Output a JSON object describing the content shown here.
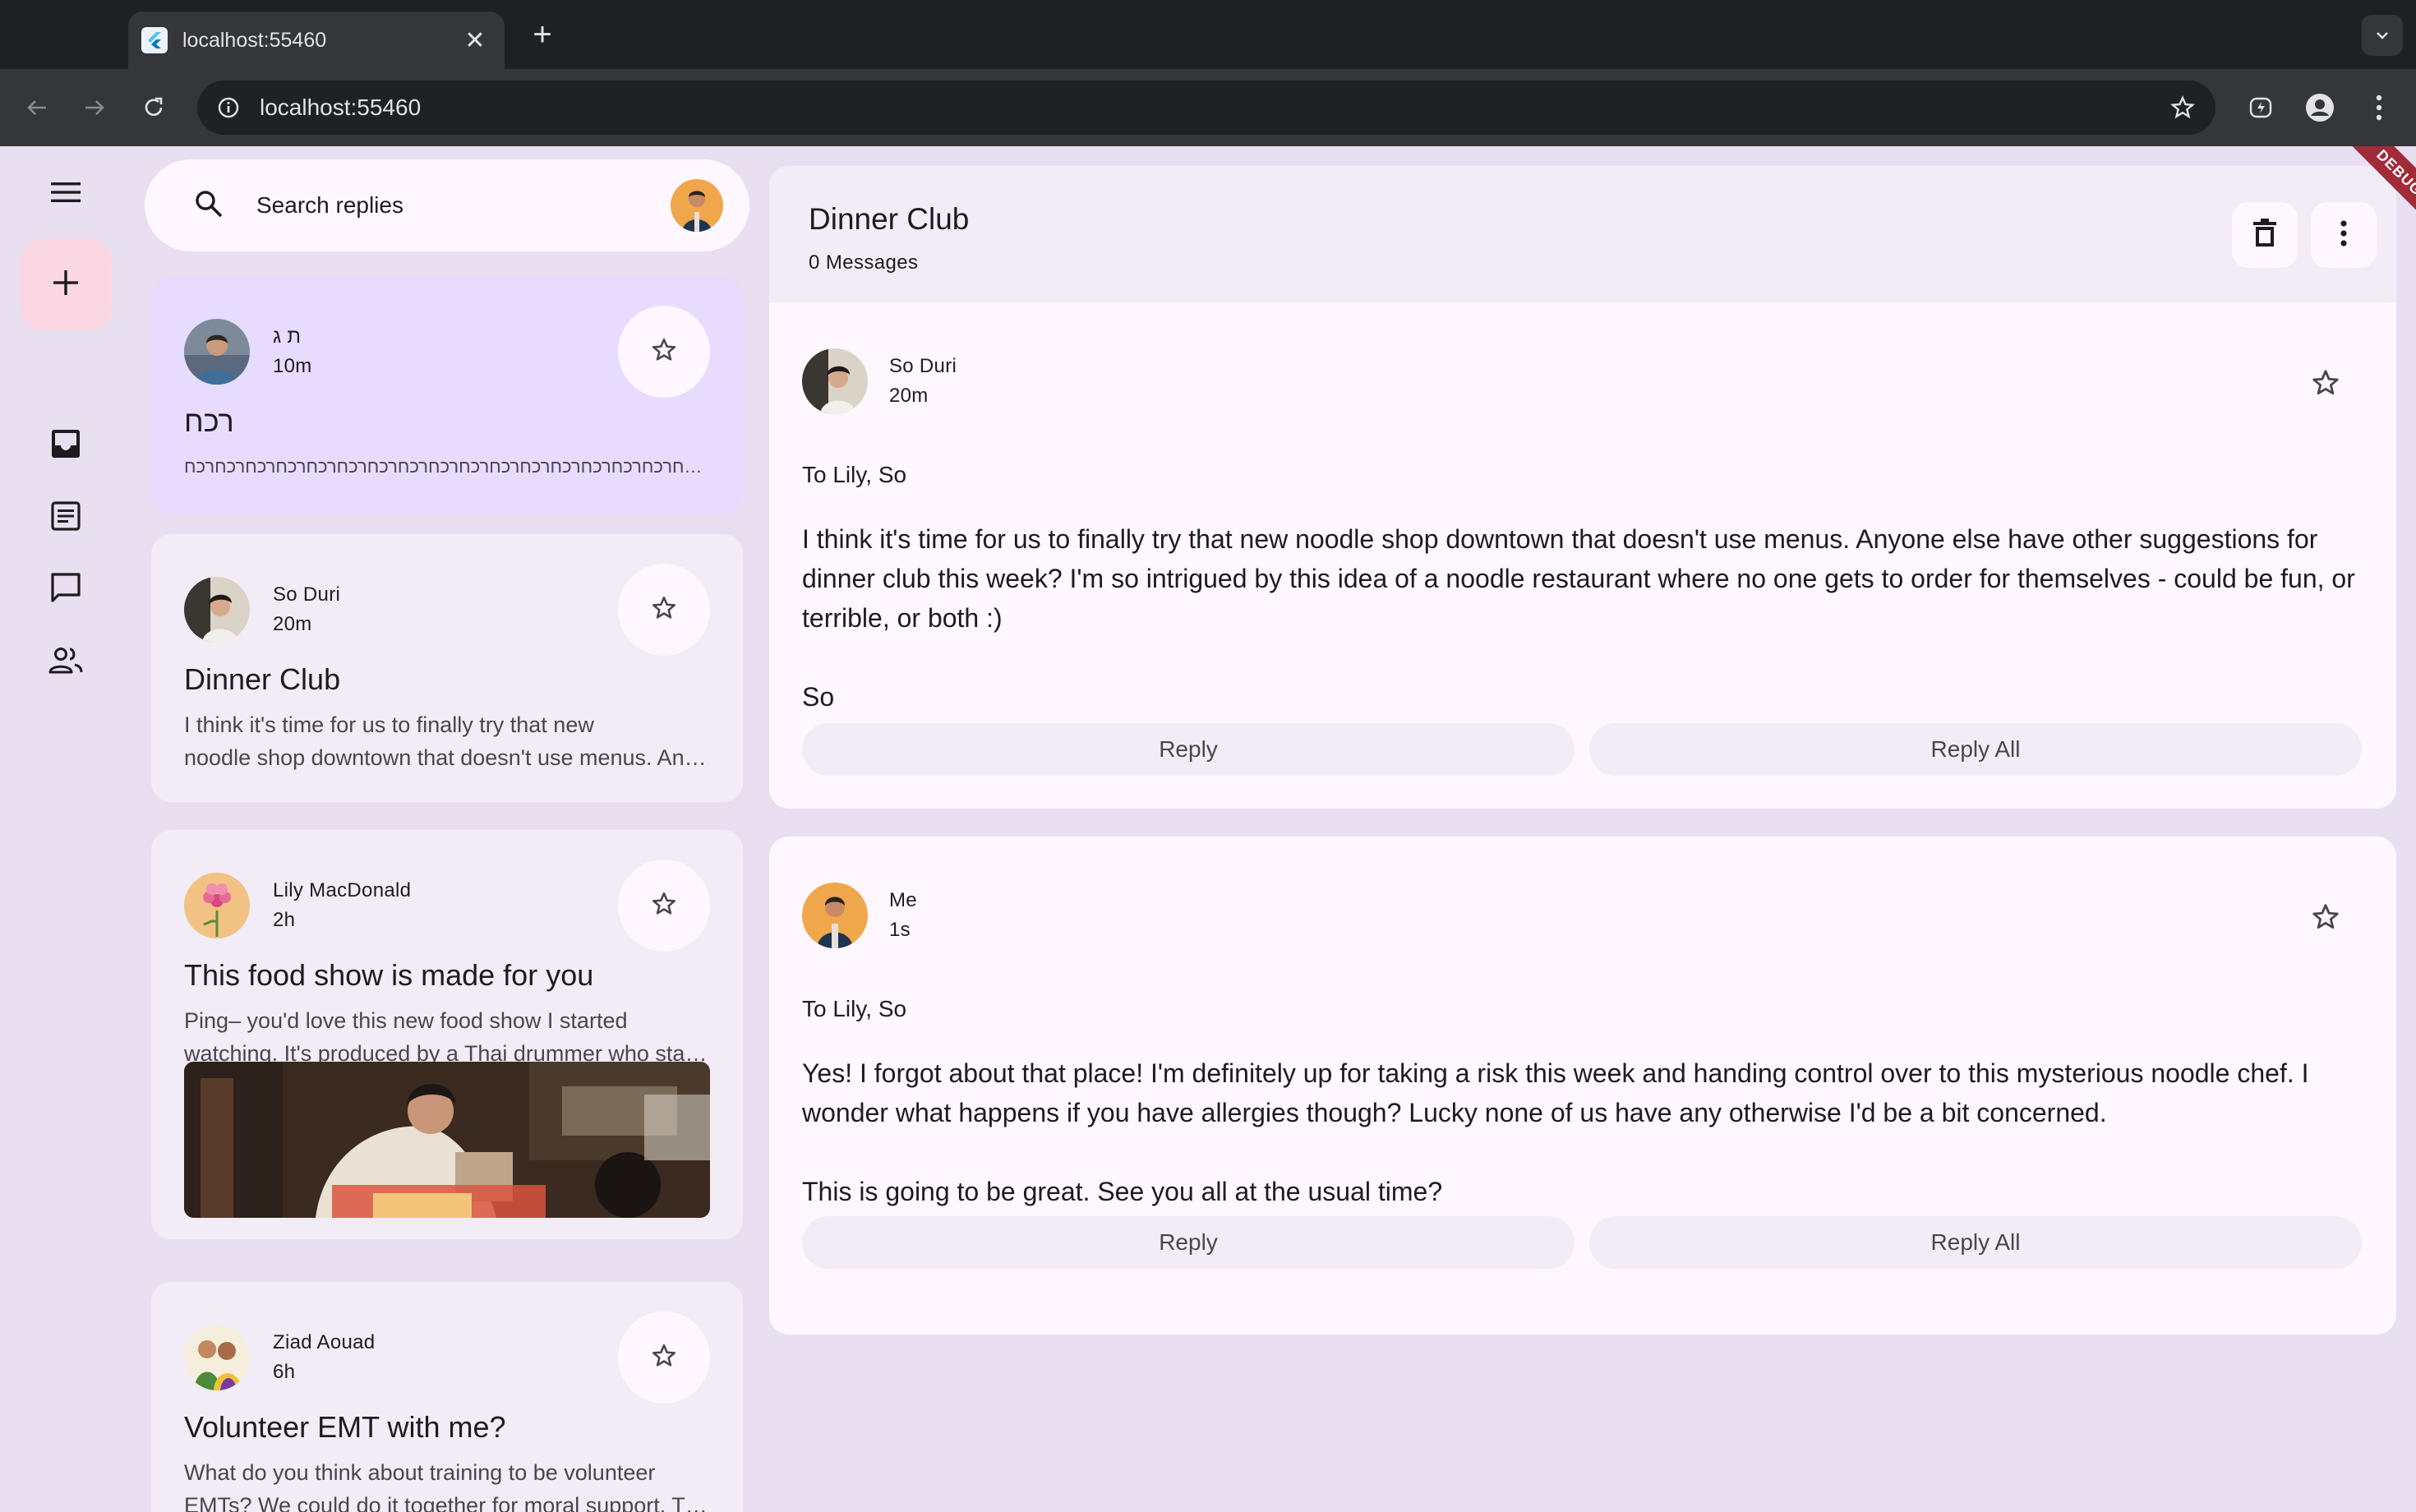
{
  "browser": {
    "tab_title": "localhost:55460",
    "url": "localhost:55460"
  },
  "rail": {
    "icons": [
      "menu-icon",
      "compose-icon",
      "inbox-icon",
      "articles-icon",
      "chat-icon",
      "contacts-icon"
    ]
  },
  "search": {
    "placeholder": "Search replies"
  },
  "emails": [
    {
      "sender": "ת ג",
      "time": "10m",
      "subject": "רכח",
      "body": [
        "רכחרכחרכחרכחרכחרכחרכחרכחרכחרכחרכחרכחרכחרכחרכחרכחרכחרכחרכח"
      ],
      "selected": true
    },
    {
      "sender": "So Duri",
      "time": "20m",
      "subject": "Dinner Club",
      "body": [
        "I think it's time for us to finally try that new",
        "noodle shop downtown that doesn't use menus. Anyone else have other suggestions"
      ],
      "selected": false
    },
    {
      "sender": "Lily MacDonald",
      "time": "2h",
      "subject": "This food show is made for you",
      "body": [
        "Ping– you'd love this new food show I started",
        "watching. It's produced by a Thai drummer who started getting recognized"
      ],
      "selected": false,
      "has_image": true
    },
    {
      "sender": "Ziad Aouad",
      "time": "6h",
      "subject": "Volunteer EMT with me?",
      "body": [
        "What do you think about training to be volunteer",
        "EMTs? We could do it together for moral support. Think about it??"
      ],
      "selected": false
    }
  ],
  "detail": {
    "title": "Dinner Club",
    "subtitle": "0 Messages",
    "messages": [
      {
        "sender": "So Duri",
        "time": "20m",
        "to": "To Lily, So",
        "paragraphs": [
          "I think it's time for us to finally try that new noodle shop downtown that doesn't use menus. Anyone else have other suggestions for dinner club this week? I'm so intrigued by this idea of a noodle restaurant where no one gets to order for themselves - could be fun, or terrible, or both :)",
          "So"
        ],
        "reply_label": "Reply",
        "reply_all_label": "Reply All"
      },
      {
        "sender": "Me",
        "time": "1s",
        "to": "To Lily, So",
        "paragraphs": [
          "Yes! I forgot about that place! I'm definitely up for taking a risk this week and handing control over to this mysterious noodle chef. I wonder what happens if you have allergies though? Lucky none of us have any otherwise I'd be a bit concerned.",
          "This is going to be great. See you all at the usual time?"
        ],
        "reply_label": "Reply",
        "reply_all_label": "Reply All"
      }
    ]
  },
  "debug_banner": "DEBUG",
  "colors": {
    "background": "#e8e0f0",
    "card": "#f2ecf6",
    "selected_card": "#e7dcfd",
    "surface": "#fef7ff",
    "fab": "#fbd7e4",
    "debug_banner": "#a22b39"
  }
}
